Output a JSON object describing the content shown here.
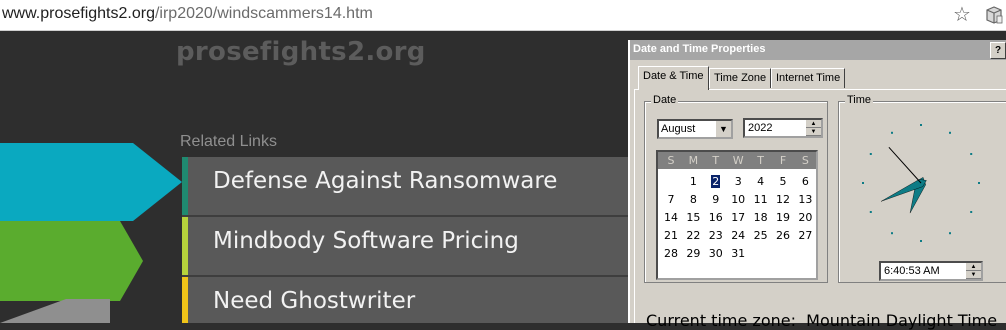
{
  "browser": {
    "url_host": "www.prosefights2.org",
    "url_path": "/irp2020/windscammers14.htm",
    "bookmark_icon": "star-icon",
    "extension_icon": "package-icon"
  },
  "webpage": {
    "site_title": "prosefights2.org",
    "related_heading": "Related Links",
    "links": [
      {
        "label": "Defense Against Ransomware",
        "accent": "#1f8a70",
        "arrow": "#0aa9c0"
      },
      {
        "label": "Mindbody Software Pricing",
        "accent": "#b6d23c",
        "arrow": "#5aac2e"
      },
      {
        "label": "Need Ghostwriter",
        "accent": "#f0c419",
        "arrow": "#8f8f8f"
      }
    ]
  },
  "dialog": {
    "title": "Date and Time Properties",
    "help_label": "?",
    "tabs": [
      "Date & Time",
      "Time Zone",
      "Internet Time"
    ],
    "active_tab": 0,
    "date_group_label": "Date",
    "time_group_label": "Time",
    "month": "August",
    "year": "2022",
    "weekdays": [
      "S",
      "M",
      "T",
      "W",
      "T",
      "F",
      "S"
    ],
    "calendar_weeks": [
      [
        "",
        "1",
        "2",
        "3",
        "4",
        "5",
        "6"
      ],
      [
        "7",
        "8",
        "9",
        "10",
        "11",
        "12",
        "13"
      ],
      [
        "14",
        "15",
        "16",
        "17",
        "18",
        "19",
        "20"
      ],
      [
        "21",
        "22",
        "23",
        "24",
        "25",
        "26",
        "27"
      ],
      [
        "28",
        "29",
        "30",
        "31",
        "",
        "",
        ""
      ]
    ],
    "selected_day": "2",
    "time_value": "6:40:53 AM",
    "clock_hours": 6,
    "clock_minutes": 40,
    "clock_seconds": 53,
    "current_timezone_label": "Current time zone:",
    "current_timezone": "Mountain Daylight Time",
    "colors": {
      "title_bg": "#a6a6a6",
      "clock_hand": "#0e7c86",
      "selected": "#0a246a"
    }
  }
}
